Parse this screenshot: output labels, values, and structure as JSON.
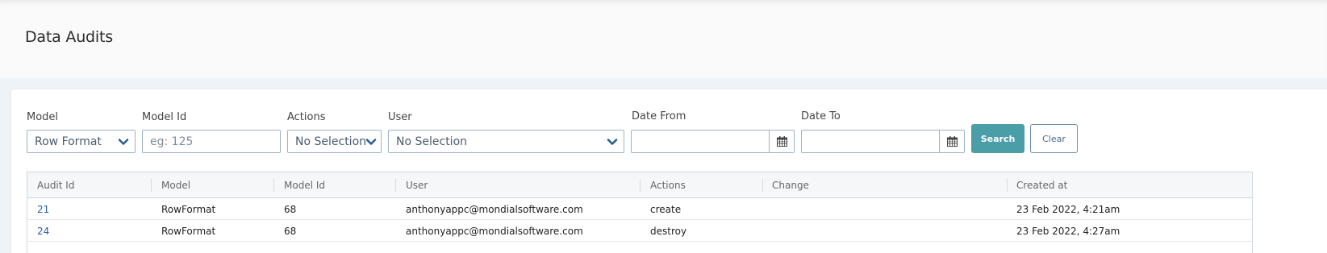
{
  "page": {
    "title": "Data Audits"
  },
  "filters": {
    "model": {
      "label": "Model",
      "value": "Row Format"
    },
    "model_id": {
      "label": "Model Id",
      "placeholder": "eg: 125"
    },
    "actions": {
      "label": "Actions",
      "value": "No Selection"
    },
    "user": {
      "label": "User",
      "value": "No Selection"
    },
    "date_from": {
      "label": "Date From",
      "value": ""
    },
    "date_to": {
      "label": "Date To",
      "value": ""
    },
    "search_label": "Search",
    "clear_label": "Clear"
  },
  "table": {
    "columns": [
      "Audit Id",
      "Model",
      "Model Id",
      "User",
      "Actions",
      "Change",
      "Created at"
    ],
    "rows": [
      {
        "audit_id": "21",
        "model": "RowFormat",
        "model_id": "68",
        "user": "anthonyappc@mondialsoftware.com",
        "action": "create",
        "change": "",
        "created_at": "23 Feb 2022, 4:21am"
      },
      {
        "audit_id": "24",
        "model": "RowFormat",
        "model_id": "68",
        "user": "anthonyappc@mondialsoftware.com",
        "action": "destroy",
        "change": "",
        "created_at": "23 Feb 2022, 4:27am"
      }
    ]
  },
  "icons": {
    "select_chevron": "chevron-down-icon",
    "date_picker": "calendar-icon"
  },
  "colors": {
    "primary_button": "#4a9ea7",
    "link": "#2a5db0",
    "field_border": "#9fb2c6",
    "chevron": "#2d5f8f"
  }
}
